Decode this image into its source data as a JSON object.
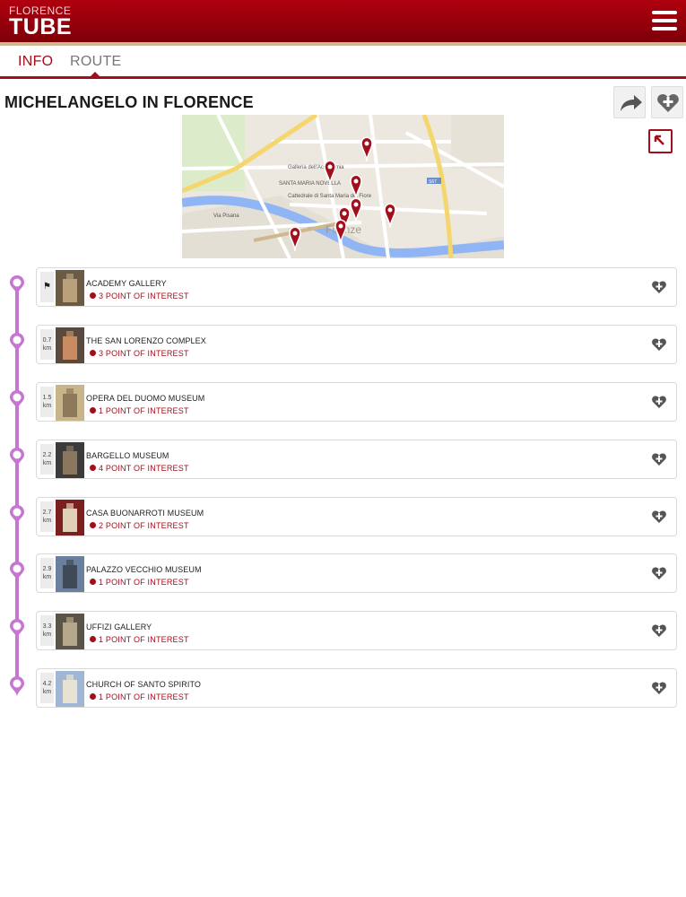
{
  "header": {
    "logo_small": "FLORENCE",
    "logo_big": "TUBE",
    "menu_icon": "hamburger-icon"
  },
  "tabs": [
    {
      "label": "INFO",
      "active": true
    },
    {
      "label": "ROUTE",
      "active": false
    }
  ],
  "page_title": "MICHELANGELO IN FLORENCE",
  "actions": {
    "share_icon": "share-arrow-icon",
    "favorite_icon": "heart-plus-icon",
    "expand_icon": "expand-map-icon"
  },
  "map": {
    "labels": [
      "Galleria dell'Accademia",
      "SANTA MARIA NOVELLA",
      "Cattedrale di Santa Maria del Fiore",
      "Firenze",
      "Via Pisana",
      "S67"
    ]
  },
  "colors": {
    "brand_red": "#a10f1c",
    "route_purple": "#c675d0",
    "header_gold": "#cdb894"
  },
  "stops": [
    {
      "name": "ACADEMY GALLERY",
      "poi": "3 POINT OF INTEREST",
      "dist": "",
      "dist_unit": "",
      "start": true
    },
    {
      "name": "THE SAN LORENZO COMPLEX",
      "poi": "3 POINT OF INTEREST",
      "dist": "0.7",
      "dist_unit": "km"
    },
    {
      "name": "OPERA DEL DUOMO MUSEUM",
      "poi": "1 POINT OF INTEREST",
      "dist": "1.5",
      "dist_unit": "km"
    },
    {
      "name": "BARGELLO MUSEUM",
      "poi": "4 POINT OF INTEREST",
      "dist": "2.2",
      "dist_unit": "km"
    },
    {
      "name": "CASA BUONARROTI MUSEUM",
      "poi": "2 POINT OF INTEREST",
      "dist": "2.7",
      "dist_unit": "km"
    },
    {
      "name": "PALAZZO VECCHIO MUSEUM",
      "poi": "1 POINT OF INTEREST",
      "dist": "2.9",
      "dist_unit": "km"
    },
    {
      "name": "UFFIZI GALLERY",
      "poi": "1 POINT OF INTEREST",
      "dist": "3.3",
      "dist_unit": "km"
    },
    {
      "name": "CHURCH OF SANTO SPIRITO",
      "poi": "1 POINT OF INTEREST",
      "dist": "4.2",
      "dist_unit": "km"
    }
  ]
}
